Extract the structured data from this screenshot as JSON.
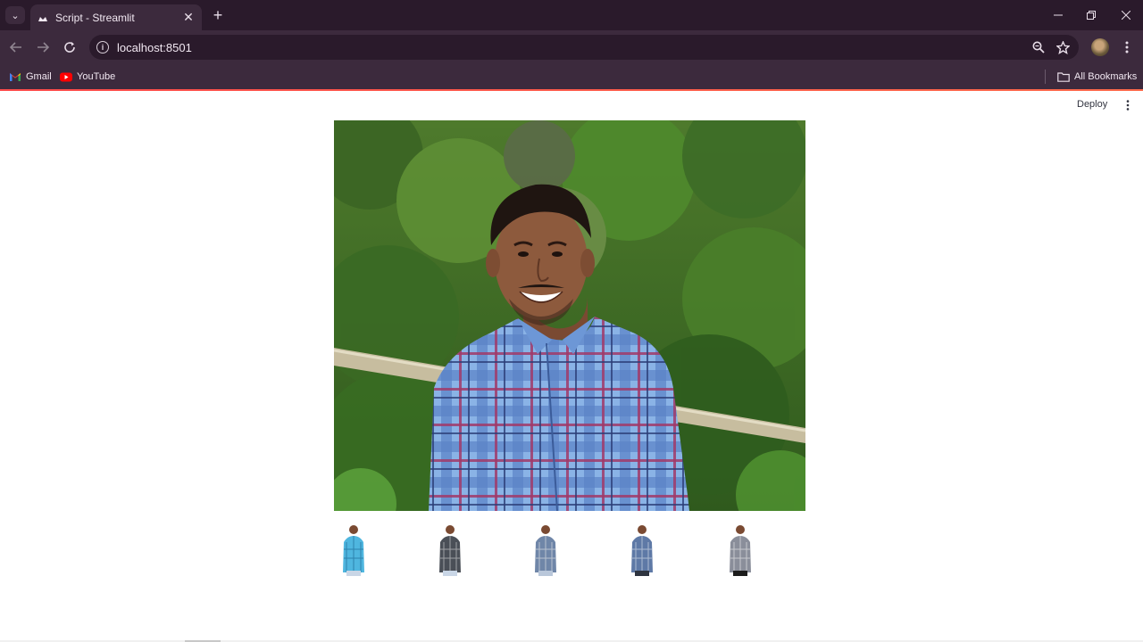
{
  "browser": {
    "tab_title": "Script - Streamlit",
    "url": "localhost:8501",
    "bookmarks": [
      {
        "label": "Gmail",
        "icon": "gmail-icon"
      },
      {
        "label": "YouTube",
        "icon": "youtube-icon"
      }
    ],
    "all_bookmarks_label": "All Bookmarks",
    "colors": {
      "frame": "#2a1a2b",
      "toolbar": "#3c2a3d",
      "accent": "#ff4b4b"
    }
  },
  "app": {
    "deploy_label": "Deploy",
    "main_image": {
      "subject": "photo-of-smiling-man-in-blue-plaid-shirt"
    },
    "thumbnails": [
      {
        "name": "shirt-option-1",
        "shirt_color": "#4fb6df"
      },
      {
        "name": "shirt-option-2",
        "shirt_color": "#4a4f57"
      },
      {
        "name": "shirt-option-3",
        "shirt_color": "#6f86a8"
      },
      {
        "name": "shirt-option-4",
        "shirt_color": "#5e79a6"
      },
      {
        "name": "shirt-option-5",
        "shirt_color": "#8a8e9a"
      }
    ]
  }
}
